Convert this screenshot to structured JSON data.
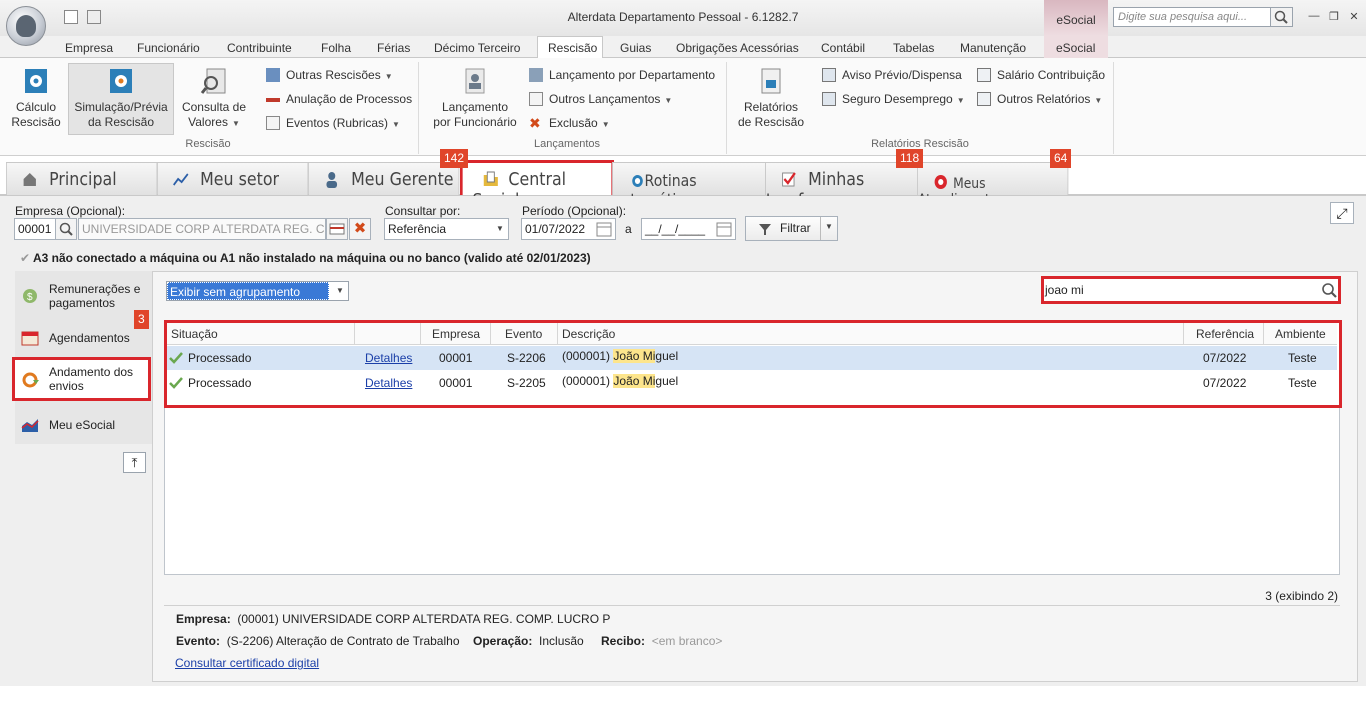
{
  "window": {
    "title": "Alterdata Departamento Pessoal - 6.1282.7",
    "context_tab": "eSocial",
    "search_placeholder": "Digite sua pesquisa aqui...",
    "controls": [
      "minimize-icon",
      "restore-icon",
      "close-icon"
    ]
  },
  "ribbon_tabs": [
    "Empresa",
    "Funcionário",
    "Contribuinte",
    "Folha",
    "Férias",
    "Décimo Terceiro",
    "Rescisão",
    "Guias",
    "Obrigações Acessórias",
    "Contábil",
    "Tabelas",
    "Manutenção",
    "eSocial"
  ],
  "active_ribbon_tab": "Rescisão",
  "ribbon": {
    "rescisao": {
      "label": "Rescisão",
      "calc": [
        "Cálculo",
        "Rescisão"
      ],
      "sim": [
        "Simulação/Prévia",
        "da Rescisão"
      ],
      "consulta": [
        "Consulta de",
        "Valores"
      ],
      "small": [
        "Outras Rescisões",
        "Anulação de Processos",
        "Eventos (Rubricas)"
      ]
    },
    "lancamentos": {
      "label": "Lançamentos",
      "lanc": [
        "Lançamento",
        "por Funcionário"
      ],
      "small": [
        "Lançamento por Departamento",
        "Outros Lançamentos",
        "Exclusão"
      ]
    },
    "relatorios": {
      "label": "Relatórios Rescisão",
      "rel": [
        "Relatórios",
        "de Rescisão"
      ],
      "small": [
        "Aviso Prévio/Dispensa",
        "Seguro Desemprego",
        "Salário Contribuição",
        "Outros Relatórios"
      ]
    }
  },
  "module_tabs": [
    {
      "label": "Principal",
      "icon": "home-icon"
    },
    {
      "label": "Meu setor",
      "icon": "chart-icon"
    },
    {
      "label": "Meu Gerente",
      "icon": "person-icon",
      "badge": "142"
    },
    {
      "label": "Central eSocial",
      "icon": "folder-icon"
    },
    {
      "label": "Rotinas automáticas",
      "icon": "clock-icon"
    },
    {
      "label": "Minhas tarefas",
      "icon": "checkbox-icon",
      "badge": "118"
    },
    {
      "label": "Meus Atendimentos",
      "icon": "lifebuoy-icon",
      "badge": "64"
    }
  ],
  "filters": {
    "empresa_label": "Empresa (Opcional):",
    "empresa_code": "00001",
    "empresa_name": "UNIVERSIDADE CORP ALTERDATA REG. COMP",
    "consultar_label": "Consultar por:",
    "consultar_value": "Referência",
    "periodo_label": "Período (Opcional):",
    "periodo_start": "01/07/2022",
    "periodo_sep": "a",
    "periodo_end": "__/__/____",
    "filtrar": "Filtrar"
  },
  "warning": "A3 não conectado a máquina ou A1 não instalado na máquina ou no banco (valido até 02/01/2023)",
  "sidenav": {
    "items": [
      "Remunerações e pagamentos",
      "Agendamentos",
      "Andamento dos envios",
      "Meu eSocial"
    ],
    "badge": "3"
  },
  "grouping": "Exibir sem agrupamento",
  "search_value": "joao mi",
  "grid": {
    "columns": [
      "Situação",
      "",
      "Empresa",
      "Evento",
      "Descrição",
      "Referência",
      "Ambiente"
    ],
    "rows": [
      {
        "situacao": "Processado",
        "detalhes": "Detalhes",
        "empresa": "00001",
        "evento": "S-2206",
        "desc_prefix": "(000001)",
        "desc_match": "João Mi",
        "desc_rest": "guel",
        "referencia": "07/2022",
        "ambiente": "Teste"
      },
      {
        "situacao": "Processado",
        "detalhes": "Detalhes",
        "empresa": "00001",
        "evento": "S-2205",
        "desc_prefix": "(000001)",
        "desc_match": "João Mi",
        "desc_rest": "guel",
        "referencia": "07/2022",
        "ambiente": "Teste"
      }
    ],
    "count": "3 (exibindo 2)"
  },
  "details": {
    "empresa_label": "Empresa:",
    "empresa_value": "(00001) UNIVERSIDADE CORP ALTERDATA REG. COMP. LUCRO P",
    "evento_label": "Evento:",
    "evento_value": "(S-2206) Alteração de Contrato de Trabalho",
    "operacao_label": "Operação:",
    "operacao_value": "Inclusão",
    "recibo_label": "Recibo:",
    "recibo_value": "<em branco>",
    "cert_link": "Consultar certificado digital"
  },
  "colors": {
    "highlight_red": "#d9262c",
    "badge": "#e0452a",
    "selection_blue": "#3a79d6",
    "match_yellow": "#fde58c"
  }
}
